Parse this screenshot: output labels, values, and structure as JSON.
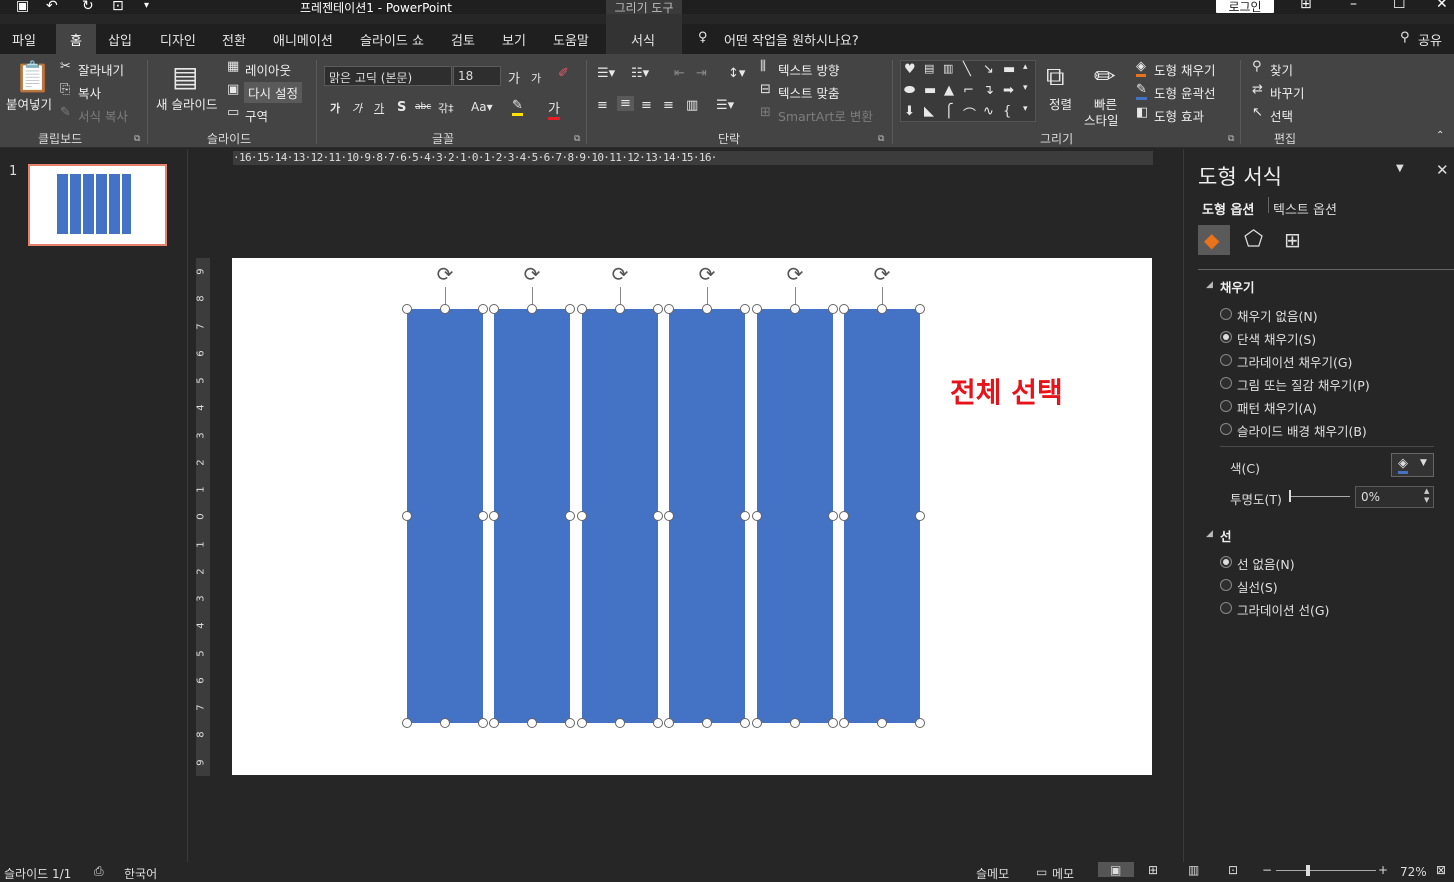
{
  "window": {
    "title": "프레젠테이션1  -  PowerPoint",
    "context_tab_title": "그리기 도구",
    "login_label": "로그인"
  },
  "tabs": {
    "items": [
      "파일",
      "홈",
      "삽입",
      "디자인",
      "전환",
      "애니메이션",
      "슬라이드 쇼",
      "검토",
      "보기",
      "도움말",
      "서식"
    ],
    "active": "홈",
    "tell_me": "어떤 작업을 원하시나요?",
    "share": "공유"
  },
  "ribbon": {
    "clipboard": {
      "label": "클립보드",
      "paste": "붙여넣기",
      "cut": "잘라내기",
      "copy": "복사",
      "format_painter": "서식 복사"
    },
    "slides": {
      "label": "슬라이드",
      "new_slide": "새 슬라이드",
      "layout": "레이아웃",
      "reset": "다시 설정",
      "section": "구역"
    },
    "font": {
      "label": "글꼴",
      "font_name": "맑은 고딕 (본문)",
      "font_size": "18"
    },
    "paragraph": {
      "label": "단락",
      "text_direction": "텍스트 방향",
      "align_text": "텍스트 맞춤",
      "smartart": "SmartArt로 변환"
    },
    "drawing": {
      "label": "그리기",
      "arrange": "정렬",
      "quick_styles_line1": "빠른",
      "quick_styles_line2": "스타일",
      "shape_fill": "도형 채우기",
      "shape_outline": "도형 윤곽선",
      "shape_effects": "도형 효과"
    },
    "editing": {
      "label": "편집",
      "find": "찾기",
      "replace": "바꾸기",
      "select": "선택"
    }
  },
  "thumbnails": {
    "slide_number": "1"
  },
  "hruler": {
    "text": "·16·15·14·13·12·11·10·9·8·7·6·5·4·3·2·1·0·1·2·3·4·5·6·7·8·9·10·11·12·13·14·15·16·"
  },
  "vruler": {
    "ticks": [
      "9",
      "8",
      "7",
      "6",
      "5",
      "4",
      "3",
      "2",
      "1",
      "0",
      "1",
      "2",
      "3",
      "4",
      "5",
      "6",
      "7",
      "8",
      "9"
    ]
  },
  "slide": {
    "annotation": "전체 선택",
    "annotation_color": "#e8131a",
    "shape_color": "#4472c4"
  },
  "format_pane": {
    "title": "도형 서식",
    "tab_shape_options": "도형 옵션",
    "tab_text_options": "텍스트 옵션",
    "fill_section": "채우기",
    "fill_options": [
      {
        "label": "채우기 없음(N)",
        "selected": false
      },
      {
        "label": "단색 채우기(S)",
        "selected": true
      },
      {
        "label": "그라데이션 채우기(G)",
        "selected": false
      },
      {
        "label": "그림 또는 질감 채우기(P)",
        "selected": false
      },
      {
        "label": "패턴 채우기(A)",
        "selected": false
      },
      {
        "label": "슬라이드 배경 채우기(B)",
        "selected": false
      }
    ],
    "color_label": "색(C)",
    "transparency_label": "투명도(T)",
    "transparency_value": "0%",
    "line_section": "선",
    "line_options": [
      {
        "label": "선 없음(N)",
        "selected": true
      },
      {
        "label": "실선(S)",
        "selected": false
      },
      {
        "label": "그라데이션 선(G)",
        "selected": false
      }
    ]
  },
  "status": {
    "slide_counter": "슬라이드 1/1",
    "language": "한국어",
    "notes": "슬메모",
    "comments": "메모",
    "zoom": "72%"
  }
}
